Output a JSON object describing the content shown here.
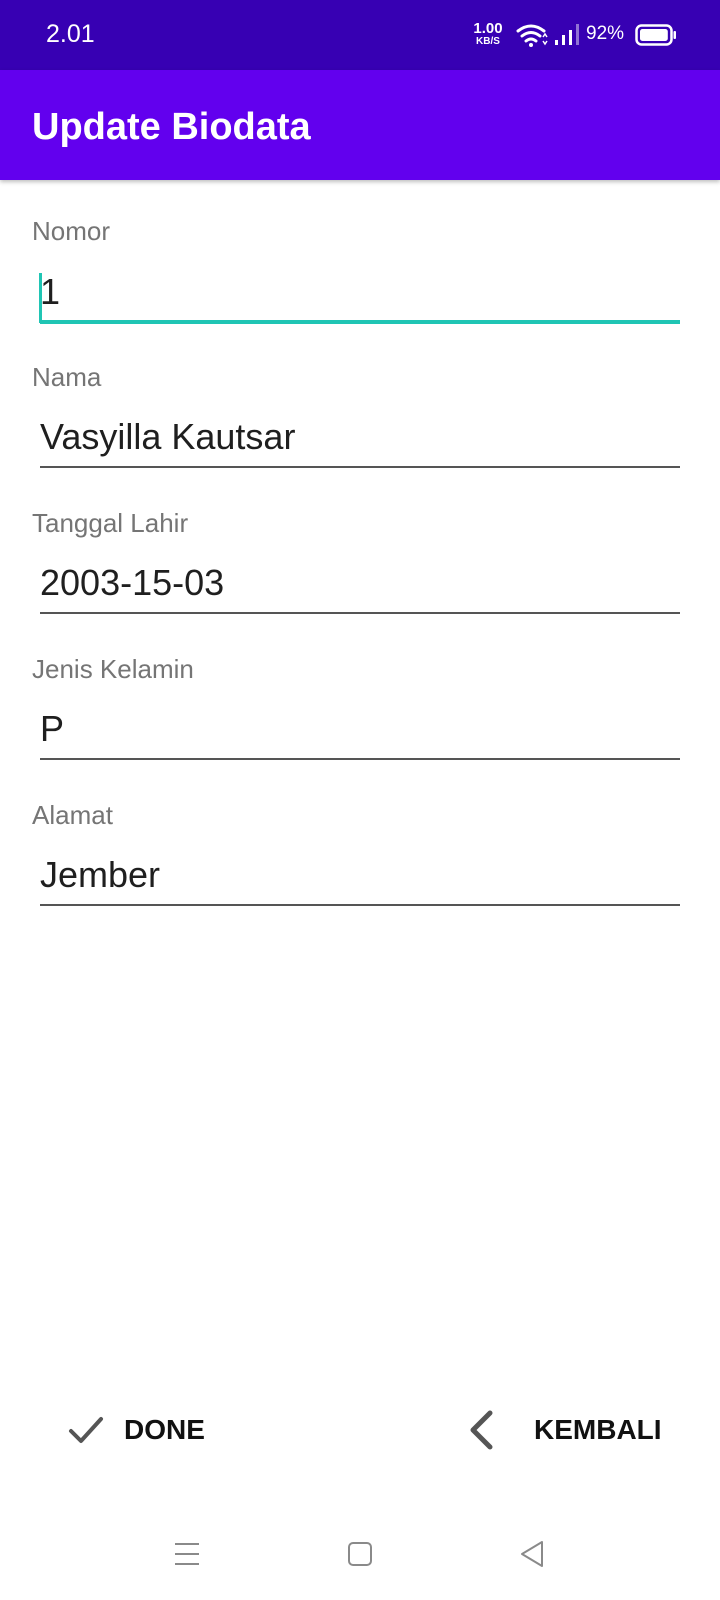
{
  "status_bar": {
    "time": "2.01",
    "net_speed_value": "1.00",
    "net_speed_unit": "KB/S",
    "battery_percent": "92%",
    "battery_level": 0.92
  },
  "app_bar": {
    "title": "Update Biodata",
    "color": "#6200ee",
    "status_color": "#3700b3"
  },
  "form": {
    "fields": [
      {
        "label": "Nomor",
        "value": "1"
      },
      {
        "label": "Nama",
        "value": "Vasyilla Kautsar"
      },
      {
        "label": "Tanggal Lahir",
        "value": "2003-15-03"
      },
      {
        "label": "Jenis Kelamin",
        "value": "P"
      },
      {
        "label": "Alamat",
        "value": "Jember"
      }
    ],
    "focus_color": "#20c5b4"
  },
  "actions": {
    "done_label": "DONE",
    "done_icon": "check-icon",
    "back_label": "KEMBALI",
    "back_icon": "chevron-left-icon"
  },
  "nav_bar": {
    "icons": [
      "menu-icon",
      "home-square-icon",
      "back-triangle-icon"
    ]
  }
}
